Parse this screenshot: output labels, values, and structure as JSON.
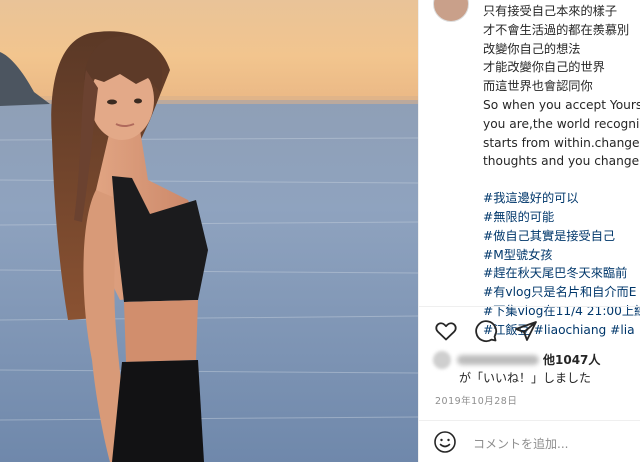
{
  "post": {
    "caption_lines": [
      "只有接受自己本來的樣子",
      "才不會生活過的都在羨慕別",
      "改變你自己的想法",
      "才能改變你自己的世界",
      "而這世界也會認同你",
      "So when you accept Yours",
      "you are,the world recogni",
      "starts from within.change",
      "thoughts and you change"
    ],
    "hashtags": [
      "#我這邊好的可以",
      "#無限的可能",
      "#做自己其實是接受自己",
      "#M型號女孩",
      "#趕在秋天尾巴冬天來臨前",
      "#有vlog只是名片和自介而E",
      "#下集vlog在11/4 21:00上線",
      "#江飯豆 #liaochiang #lia"
    ],
    "likes_count": "他1047人",
    "likes_suffix": "が「いいね！」しました",
    "date": "2019年10月28日",
    "comment_placeholder": "コメントを追加..."
  },
  "icons": {
    "like": "heart-icon",
    "comment": "comment-icon",
    "share": "share-icon",
    "emoji": "emoji-icon"
  },
  "colors": {
    "text": "#262626",
    "hashtag": "#00376b",
    "muted": "#8e8e8e",
    "divider": "#efefef"
  }
}
